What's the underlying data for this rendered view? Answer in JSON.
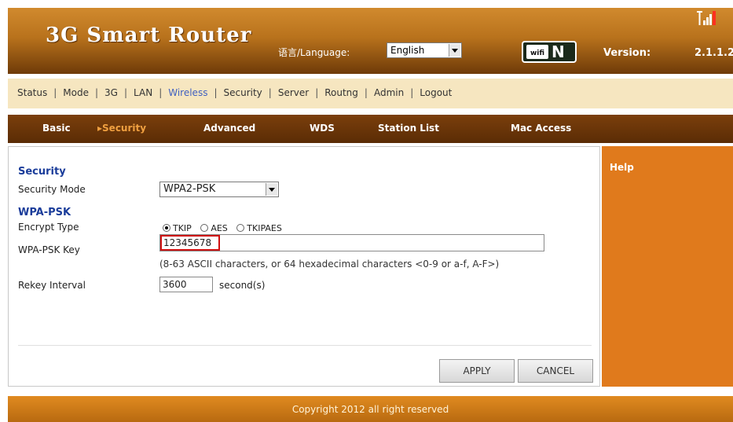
{
  "header": {
    "title": "3G Smart Router",
    "language_label": "语言/Language:",
    "language_selected": "English",
    "wifi_badge_text": "wifi",
    "wifi_badge_letter": "N",
    "version_label": "Version:",
    "version_value": "2.1.1.2"
  },
  "top_nav": {
    "items": [
      "Status",
      "Mode",
      "3G",
      "LAN",
      "Wireless",
      "Security",
      "Server",
      "Routng",
      "Admin",
      "Logout"
    ],
    "active": "Wireless"
  },
  "sub_nav": {
    "items": [
      "Basic",
      "Security",
      "Advanced",
      "WDS",
      "Station List",
      "Mac Access"
    ],
    "active": "Security"
  },
  "content": {
    "section_security": "Security",
    "security_mode_label": "Security Mode",
    "security_mode_value": "WPA2-PSK",
    "section_wpa": "WPA-PSK",
    "encrypt_type_label": "Encrypt Type",
    "encrypt_options": [
      "TKIP",
      "AES",
      "TKIPAES"
    ],
    "encrypt_selected": "TKIP",
    "wpa_key_label": "WPA-PSK Key",
    "wpa_key_value": "12345678",
    "key_hint": "(8-63 ASCII characters, or 64 hexadecimal characters <0-9 or a-f, A-F>)",
    "rekey_label": "Rekey Interval",
    "rekey_value": "3600",
    "rekey_unit": "second(s)",
    "apply_label": "APPLY",
    "cancel_label": "CANCEL"
  },
  "help": {
    "title": "Help"
  },
  "footer": {
    "text": "Copyright 2012 all right reserved"
  },
  "colors": {
    "header_brown": "#b8721c",
    "subnav_brown": "#6b3508",
    "help_orange": "#e07a1c",
    "nav_bg": "#f6e6c0",
    "active_link": "#4060c0",
    "section_title": "#1a3c9a",
    "highlight_red": "#d01010"
  },
  "icons": [
    "signal-icon",
    "wifi-n-logo",
    "dropdown-arrow-icon",
    "menu-arrow-icon"
  ]
}
